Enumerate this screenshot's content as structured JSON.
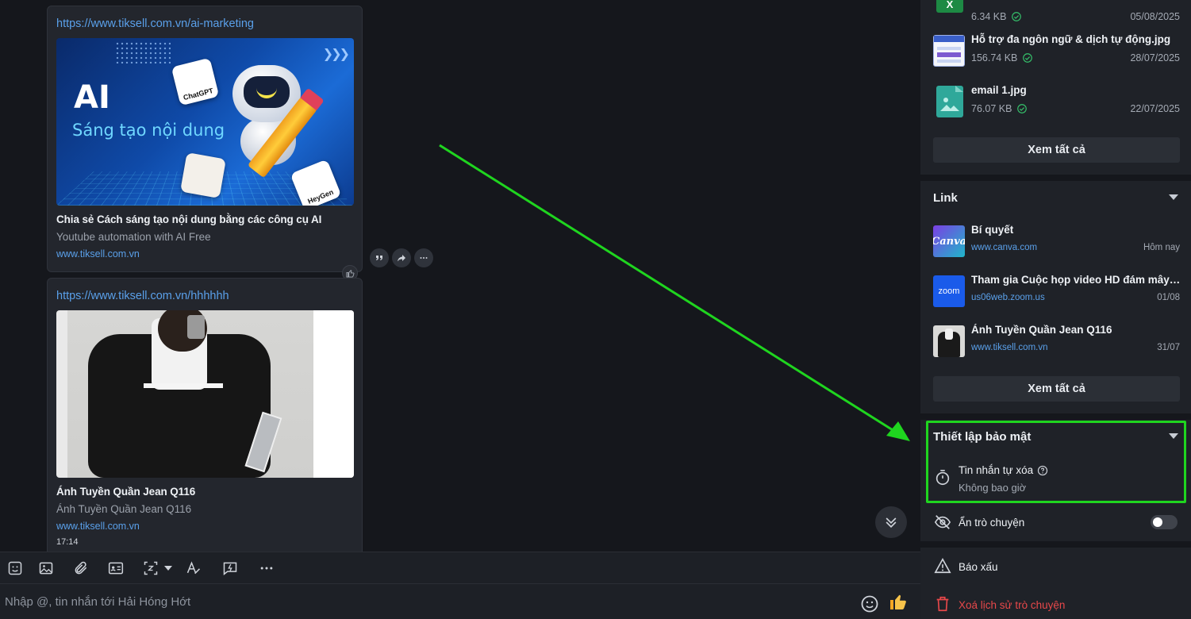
{
  "messages": [
    {
      "url": "https://www.tiksell.com.vn/ai-marketing",
      "image_text": {
        "big": "AI",
        "sub": "Sáng tạo nội dung",
        "chip1": "ChatGPT",
        "chip3": "HeyGen"
      },
      "title": "Chia sẻ Cách sáng tạo nội dung bằng các công cụ AI",
      "desc": "Youtube automation with AI Free",
      "domain": "www.tiksell.com.vn"
    },
    {
      "url": "https://www.tiksell.com.vn/hhhhhh",
      "title": "Ánh Tuyền Quần Jean Q116",
      "desc": "Ánh Tuyền Quần Jean Q116",
      "domain": "www.tiksell.com.vn",
      "time": "17:14"
    }
  ],
  "composer": {
    "placeholder": "Nhập @, tin nhắn tới Hải Hóng Hớt"
  },
  "toolbar_icons": [
    "sticker-icon",
    "image-icon",
    "attachment-icon",
    "contact-card-icon",
    "screenshot-icon",
    "format-text-icon",
    "quick-message-icon",
    "more-icon"
  ],
  "files": {
    "items": [
      {
        "name": "",
        "size": "6.34 KB",
        "date": "05/08/2025",
        "icon": "excel-icon",
        "color": "#1d8a44"
      },
      {
        "name": "Hỗ trợ đa ngôn ngữ & dịch tự động.jpg",
        "size": "156.74 KB",
        "date": "28/07/2025",
        "icon": "image-thumb",
        "color": "#3a5fc8"
      },
      {
        "name": "email 1.jpg",
        "size": "76.07 KB",
        "date": "22/07/2025",
        "icon": "image-file-icon",
        "color": "#2fa89a"
      }
    ],
    "see_all": "Xem tất cả"
  },
  "links": {
    "title": "Link",
    "items": [
      {
        "title": "Bí quyết",
        "domain": "www.canva.com",
        "date": "Hôm nay",
        "thumb_text": "Canva"
      },
      {
        "title": "Tham gia Cuộc họp video HD đám mây Zoom",
        "domain": "us06web.zoom.us",
        "date": "01/08",
        "thumb_text": "zoom"
      },
      {
        "title": "Ánh Tuyền Quần Jean Q116",
        "domain": "www.tiksell.com.vn",
        "date": "31/07",
        "thumb_text": ""
      }
    ],
    "see_all": "Xem tất cả"
  },
  "security": {
    "title": "Thiết lập bảo mật",
    "auto_delete_label": "Tin nhắn tự xóa",
    "auto_delete_value": "Không bao giờ",
    "hide_chat_label": "Ẩn trò chuyện",
    "hide_chat_on": false
  },
  "actions": {
    "report": "Báo xấu",
    "delete_history": "Xoá lịch sử trò chuyện"
  },
  "colors": {
    "accent_link": "#5aa0ea",
    "highlight": "#1fd51f",
    "danger": "#e8484a"
  }
}
